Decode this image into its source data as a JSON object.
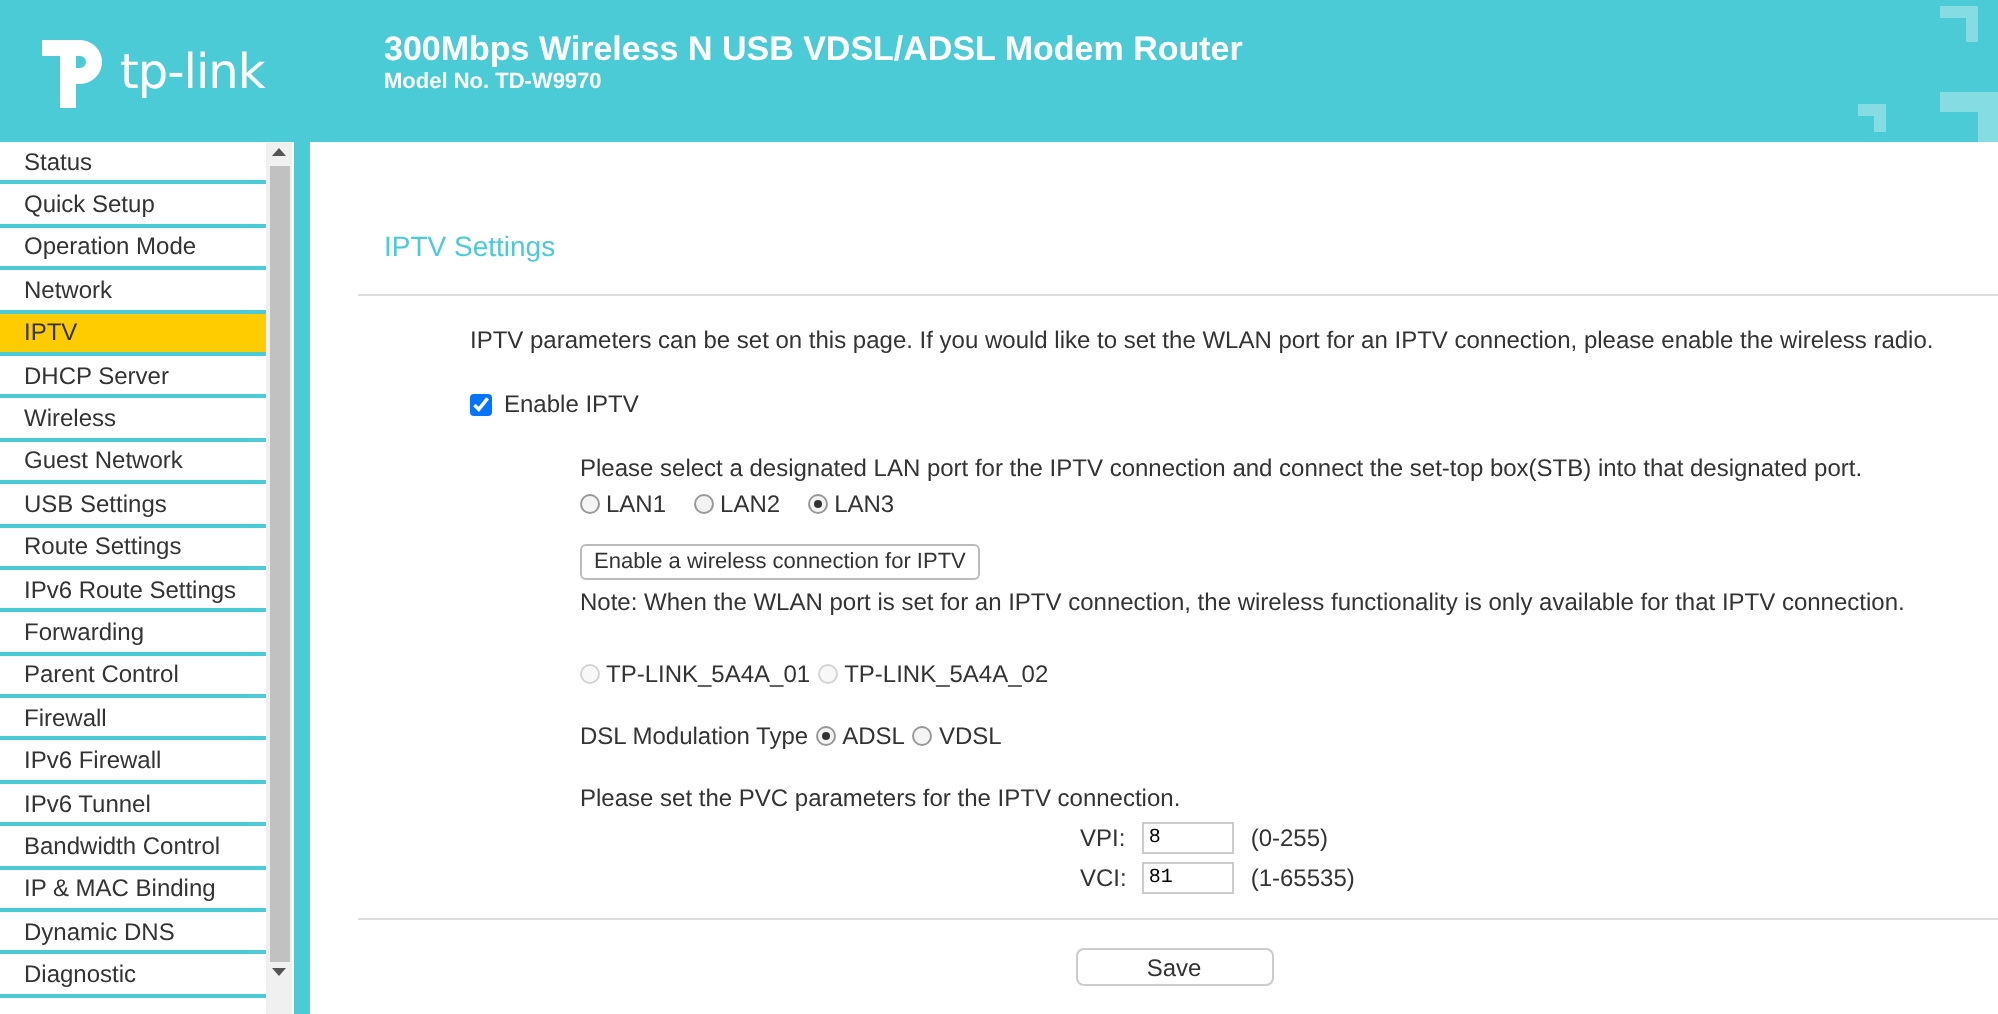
{
  "header": {
    "logo_text": "tp-link",
    "title": "300Mbps Wireless N USB VDSL/ADSL Modem Router",
    "model": "Model No. TD-W9970"
  },
  "sidebar": {
    "items": [
      {
        "label": "Status",
        "selected": false
      },
      {
        "label": "Quick Setup",
        "selected": false
      },
      {
        "label": "Operation Mode",
        "selected": false
      },
      {
        "label": "Network",
        "selected": false
      },
      {
        "label": "IPTV",
        "selected": true
      },
      {
        "label": "DHCP Server",
        "selected": false
      },
      {
        "label": "Wireless",
        "selected": false
      },
      {
        "label": "Guest Network",
        "selected": false
      },
      {
        "label": "USB Settings",
        "selected": false
      },
      {
        "label": "Route Settings",
        "selected": false
      },
      {
        "label": "IPv6 Route Settings",
        "selected": false
      },
      {
        "label": "Forwarding",
        "selected": false
      },
      {
        "label": "Parent Control",
        "selected": false
      },
      {
        "label": "Firewall",
        "selected": false
      },
      {
        "label": "IPv6 Firewall",
        "selected": false
      },
      {
        "label": "IPv6 Tunnel",
        "selected": false
      },
      {
        "label": "Bandwidth Control",
        "selected": false
      },
      {
        "label": "IP & MAC Binding",
        "selected": false
      },
      {
        "label": "Dynamic DNS",
        "selected": false
      },
      {
        "label": "Diagnostic",
        "selected": false
      }
    ]
  },
  "content": {
    "title": "IPTV Settings",
    "intro": "IPTV parameters can be set on this page. If you would like to set the WLAN port for an IPTV connection, please enable the wireless radio.",
    "enable_iptv": {
      "label": "Enable IPTV",
      "checked": true
    },
    "lan_prompt": "Please select a designated LAN port for the IPTV connection and connect the set-top box(STB) into that designated port.",
    "lan_ports": [
      {
        "label": "LAN1",
        "selected": false
      },
      {
        "label": "LAN2",
        "selected": false
      },
      {
        "label": "LAN3",
        "selected": true
      }
    ],
    "wireless_button": "Enable a wireless connection for IPTV",
    "note": "Note: When the WLAN port is set for an IPTV connection, the wireless functionality is only available for that IPTV connection.",
    "ssids": [
      {
        "label": "TP-LINK_5A4A_01",
        "selected": false,
        "disabled": true
      },
      {
        "label": "TP-LINK_5A4A_02",
        "selected": false,
        "disabled": true
      }
    ],
    "modulation": {
      "label": "DSL Modulation Type",
      "options": [
        {
          "label": "ADSL",
          "selected": true
        },
        {
          "label": "VDSL",
          "selected": false
        }
      ]
    },
    "pvc_prompt": "Please set the PVC parameters for the IPTV connection.",
    "pvc_fields": [
      {
        "label": "VPI:",
        "value": "8",
        "range": "(0-255)"
      },
      {
        "label": "VCI:",
        "value": "81",
        "range": "(1-65535)"
      }
    ],
    "save_button": "Save"
  }
}
